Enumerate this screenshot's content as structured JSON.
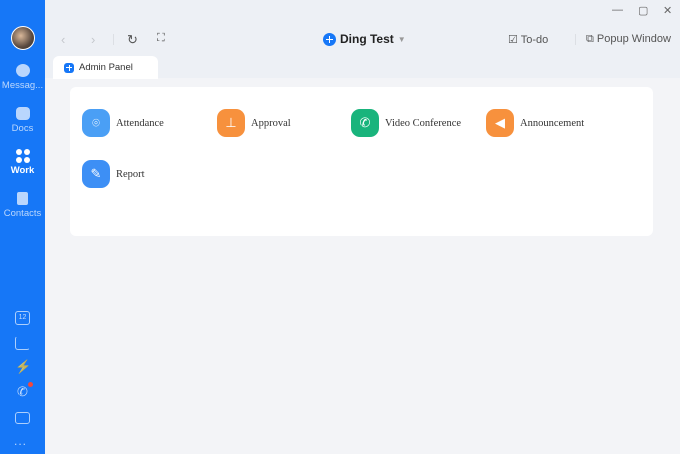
{
  "sidebar": {
    "items": [
      {
        "label": "Messag...",
        "icon": "chat-icon"
      },
      {
        "label": "Docs",
        "icon": "folder-icon"
      },
      {
        "label": "Work",
        "icon": "grid-icon",
        "active": true
      },
      {
        "label": "Contacts",
        "icon": "contacts-icon"
      }
    ],
    "calendar_day": "12",
    "more": "..."
  },
  "header": {
    "title": "Ding Test",
    "todo": "To-do",
    "popup": "Popup Window"
  },
  "tab": {
    "label": "Admin Panel"
  },
  "apps": [
    {
      "label": "Attendance",
      "color": "#4a9ff5",
      "glyph": "⌾"
    },
    {
      "label": "Approval",
      "color": "#f7913d",
      "glyph": "⊥"
    },
    {
      "label": "Video Conference",
      "color": "#19b47c",
      "glyph": "✆"
    },
    {
      "label": "Announcement",
      "color": "#f7913d",
      "glyph": "◀"
    },
    {
      "label": "Report",
      "color": "#3d8ff5",
      "glyph": "✎"
    }
  ],
  "colors": {
    "sidebar": "#1677f7",
    "background": "#edf0f5"
  }
}
